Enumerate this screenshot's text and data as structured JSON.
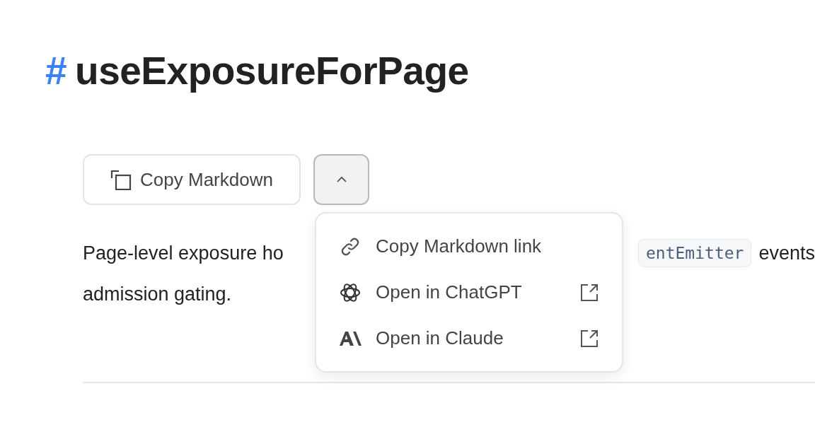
{
  "heading": {
    "hash": "#",
    "title": "useExposureForPage"
  },
  "copy_button": {
    "label": "Copy Markdown"
  },
  "menu_toggle": {
    "expanded": true
  },
  "menu": {
    "items": [
      {
        "kind": "link",
        "label": "Copy Markdown link",
        "external": false
      },
      {
        "kind": "chatgpt",
        "label": "Open in ChatGPT",
        "external": true
      },
      {
        "kind": "claude",
        "label": "Open in Claude",
        "external": true
      }
    ]
  },
  "paragraph": {
    "line_1_start": "Page-level exposure ho",
    "code": "entEmitter",
    "line_1_end": "events",
    "line_2": "admission gating."
  }
}
